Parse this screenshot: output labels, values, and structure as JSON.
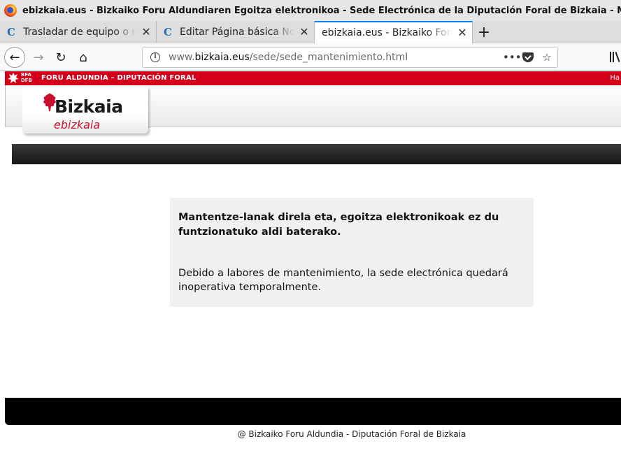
{
  "window": {
    "title": "ebizkaia.eus - Bizkaiko Foru Aldundiaren Egoitza elektronikoa - Sede Electrónica de la Diputación Foral de Bizkaia - Mozilla Firefox"
  },
  "tabs": [
    {
      "label": "Trasladar de equipo o re",
      "icon": "c-favicon-icon",
      "active": false
    },
    {
      "label": "Editar Página básica Nov",
      "icon": "c-favicon-icon",
      "active": false
    },
    {
      "label": "ebizkaia.eus - Bizkaiko Foru",
      "icon": "",
      "active": true
    }
  ],
  "tab_icon_glyph": "C",
  "tab_close_glyph": "✕",
  "newtab_glyph": "+",
  "nav": {
    "back_glyph": "←",
    "forward_glyph": "→",
    "reload_glyph": "↻",
    "home_glyph": "⌂",
    "url_prefix": "www.",
    "url_domain": "bizkaia.eus",
    "url_path": "/sede/sede_mantenimiento.html",
    "info_glyph": "i",
    "more_glyph": "•••",
    "star_glyph": "☆"
  },
  "site": {
    "bfa_line1": "BFA",
    "bfa_line2": "DFB",
    "top_title": "FORU ALDUNDIA – DIPUTACIÓN FORAL",
    "top_right": "Ha",
    "logo_main": "Bizkaia",
    "logo_sub": "ebizkaia",
    "brand_red": "#d4001a"
  },
  "message": {
    "basque": "Mantentze-lanak direla eta, egoitza elektronikoak ez du funtzionatuko aldi baterako.",
    "spanish": "Debido a labores de mantenimiento, la sede electrónica quedará inoperativa temporalmente."
  },
  "footer": {
    "copyright": "@ Bizkaiko Foru Aldundia - Diputación Foral de Bizkaia"
  }
}
